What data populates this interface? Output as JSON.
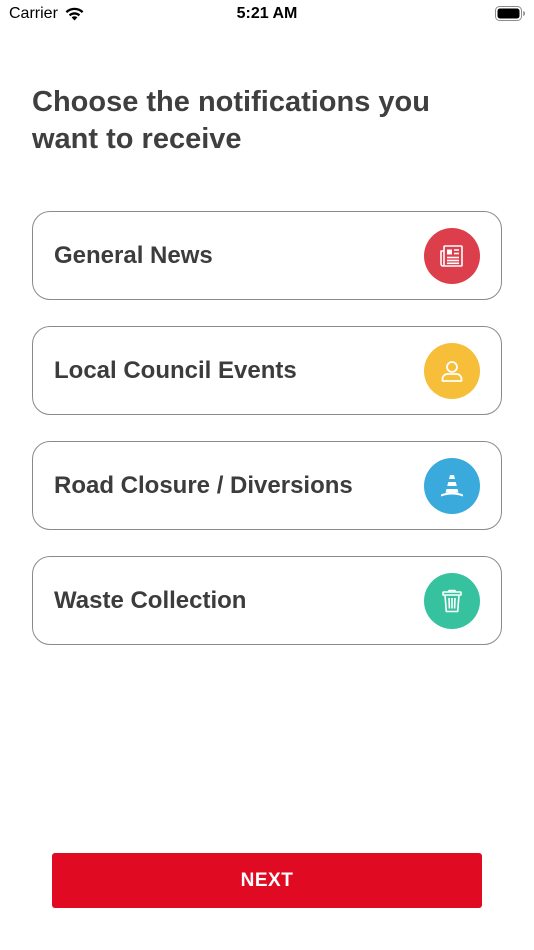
{
  "status_bar": {
    "carrier": "Carrier",
    "time": "5:21 AM",
    "wifi_icon": "wifi-icon",
    "battery_icon": "battery-icon"
  },
  "heading": "Choose the notifications you want to receive",
  "options": [
    {
      "label": "General News",
      "icon": "newspaper-icon",
      "color": "#dd3e4c"
    },
    {
      "label": "Local Council Events",
      "icon": "person-icon",
      "color": "#f6be39"
    },
    {
      "label": "Road Closure / Diversions",
      "icon": "traffic-cone-icon",
      "color": "#3aa9db"
    },
    {
      "label": "Waste Collection",
      "icon": "trash-icon",
      "color": "#37c29f"
    }
  ],
  "next_button": {
    "label": "NEXT",
    "color": "#e00b23"
  }
}
